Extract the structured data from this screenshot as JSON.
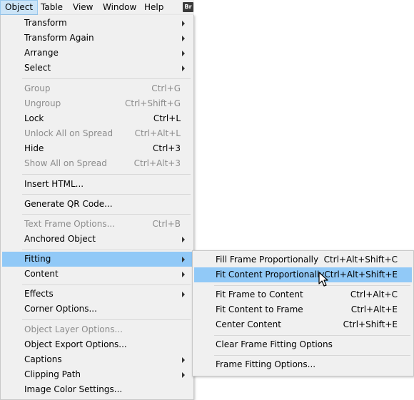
{
  "menubar": {
    "items": [
      "Object",
      "Table",
      "View",
      "Window",
      "Help"
    ],
    "active": "Object",
    "badge": "Br"
  },
  "object_menu": {
    "items": [
      {
        "label": "Transform",
        "shortcut": "",
        "submenu": true,
        "disabled": false
      },
      {
        "label": "Transform Again",
        "shortcut": "",
        "submenu": true,
        "disabled": false
      },
      {
        "label": "Arrange",
        "shortcut": "",
        "submenu": true,
        "disabled": false
      },
      {
        "label": "Select",
        "shortcut": "",
        "submenu": true,
        "disabled": false
      },
      {
        "label": "Group",
        "shortcut": "Ctrl+G",
        "submenu": false,
        "disabled": true
      },
      {
        "label": "Ungroup",
        "shortcut": "Ctrl+Shift+G",
        "submenu": false,
        "disabled": true
      },
      {
        "label": "Lock",
        "shortcut": "Ctrl+L",
        "submenu": false,
        "disabled": false
      },
      {
        "label": "Unlock All on Spread",
        "shortcut": "Ctrl+Alt+L",
        "submenu": false,
        "disabled": true
      },
      {
        "label": "Hide",
        "shortcut": "Ctrl+3",
        "submenu": false,
        "disabled": false
      },
      {
        "label": "Show All on Spread",
        "shortcut": "Ctrl+Alt+3",
        "submenu": false,
        "disabled": true
      },
      {
        "label": "Insert HTML...",
        "shortcut": "",
        "submenu": false,
        "disabled": false
      },
      {
        "label": "Generate QR Code...",
        "shortcut": "",
        "submenu": false,
        "disabled": false
      },
      {
        "label": "Text Frame Options...",
        "shortcut": "Ctrl+B",
        "submenu": false,
        "disabled": true
      },
      {
        "label": "Anchored Object",
        "shortcut": "",
        "submenu": true,
        "disabled": false
      },
      {
        "label": "Fitting",
        "shortcut": "",
        "submenu": true,
        "disabled": false,
        "highlighted": true
      },
      {
        "label": "Content",
        "shortcut": "",
        "submenu": true,
        "disabled": false
      },
      {
        "label": "Effects",
        "shortcut": "",
        "submenu": true,
        "disabled": false
      },
      {
        "label": "Corner Options...",
        "shortcut": "",
        "submenu": false,
        "disabled": false
      },
      {
        "label": "Object Layer Options...",
        "shortcut": "",
        "submenu": false,
        "disabled": true
      },
      {
        "label": "Object Export Options...",
        "shortcut": "",
        "submenu": false,
        "disabled": false
      },
      {
        "label": "Captions",
        "shortcut": "",
        "submenu": true,
        "disabled": false
      },
      {
        "label": "Clipping Path",
        "shortcut": "",
        "submenu": true,
        "disabled": false
      },
      {
        "label": "Image Color Settings...",
        "shortcut": "",
        "submenu": false,
        "disabled": false
      }
    ]
  },
  "fitting_menu": {
    "items": [
      {
        "label": "Fill Frame Proportionally",
        "shortcut": "Ctrl+Alt+Shift+C"
      },
      {
        "label": "Fit Content Proportionally",
        "shortcut": "Ctrl+Alt+Shift+E",
        "highlighted": true
      },
      {
        "label": "Fit Frame to Content",
        "shortcut": "Ctrl+Alt+C"
      },
      {
        "label": "Fit Content to Frame",
        "shortcut": "Ctrl+Alt+E"
      },
      {
        "label": "Center Content",
        "shortcut": "Ctrl+Shift+E"
      },
      {
        "label": "Clear Frame Fitting Options",
        "shortcut": ""
      },
      {
        "label": "Frame Fitting Options...",
        "shortcut": ""
      }
    ]
  },
  "colors": {
    "menu_bg": "#f0f0f0",
    "highlight": "#91c9f7",
    "disabled_text": "#8c8c8c",
    "separator": "#d7d7d7"
  },
  "icons": {
    "submenu_arrow": "chevron-right-icon",
    "cursor": "mouse-pointer-icon"
  }
}
